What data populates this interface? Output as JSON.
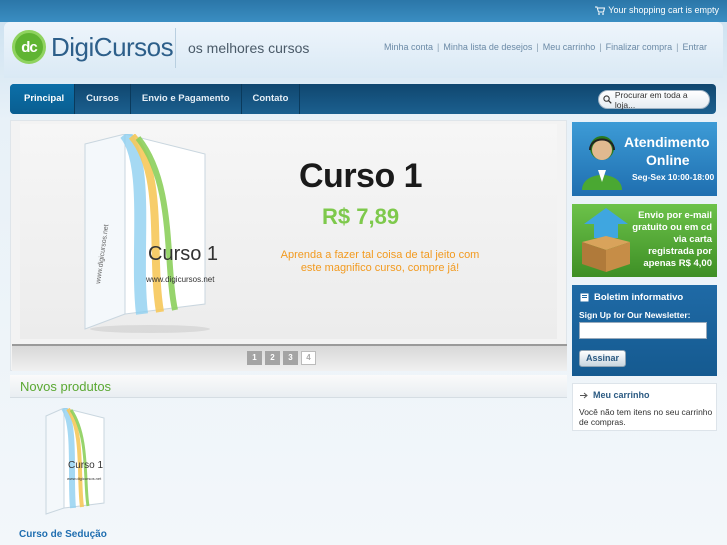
{
  "topbar": {
    "cart_status": "Your shopping cart is empty",
    "cart_icon": "cart-icon"
  },
  "header": {
    "logo_mark": "dc",
    "logo_text": "DigiCursos",
    "slogan": "os melhores cursos",
    "links": [
      "Minha conta",
      "Minha lista de desejos",
      "Meu carrinho",
      "Finalizar compra",
      "Entrar"
    ]
  },
  "nav": {
    "items": [
      "Principal",
      "Cursos",
      "Envio e Pagamento",
      "Contato"
    ],
    "active_index": 0,
    "search_placeholder": "Procurar em toda a loja..."
  },
  "slider": {
    "box_label": "Curso 1",
    "box_url": "www.digicursos.net",
    "box_spine": "www.digicursos.net",
    "title": "Curso 1",
    "price": "R$ 7,89",
    "description": "Aprenda a fazer tal coisa de tal jeito com este magnifico curso, compre já!",
    "pages": [
      "1",
      "2",
      "3",
      "4"
    ],
    "active_page": 4
  },
  "new_products": {
    "heading": "Novos produtos",
    "items": [
      {
        "name": "Curso de Sedução",
        "box_label": "Curso 1",
        "box_url": "www.digicursos.net"
      }
    ]
  },
  "sidebar": {
    "atendimento": {
      "line1": "Atendimento",
      "line2": "Online",
      "hours": "Seg-Sex 10:00-18:00"
    },
    "envio": {
      "text": "Envio por e-mail gratuito ou em cd via carta registrada por apenas R$ 4,00"
    },
    "newsletter": {
      "heading": "Boletim informativo",
      "label": "Sign Up for Our Newsletter:",
      "input_value": "",
      "button": "Assinar"
    },
    "cart": {
      "heading": "Meu carrinho",
      "empty_text": "Você não tem itens no seu carrinho de compras."
    }
  },
  "colors": {
    "brand_blue": "#1b5f8f",
    "brand_green": "#5aa832",
    "price_green": "#7ec94c",
    "accent_orange": "#f29a1f"
  }
}
